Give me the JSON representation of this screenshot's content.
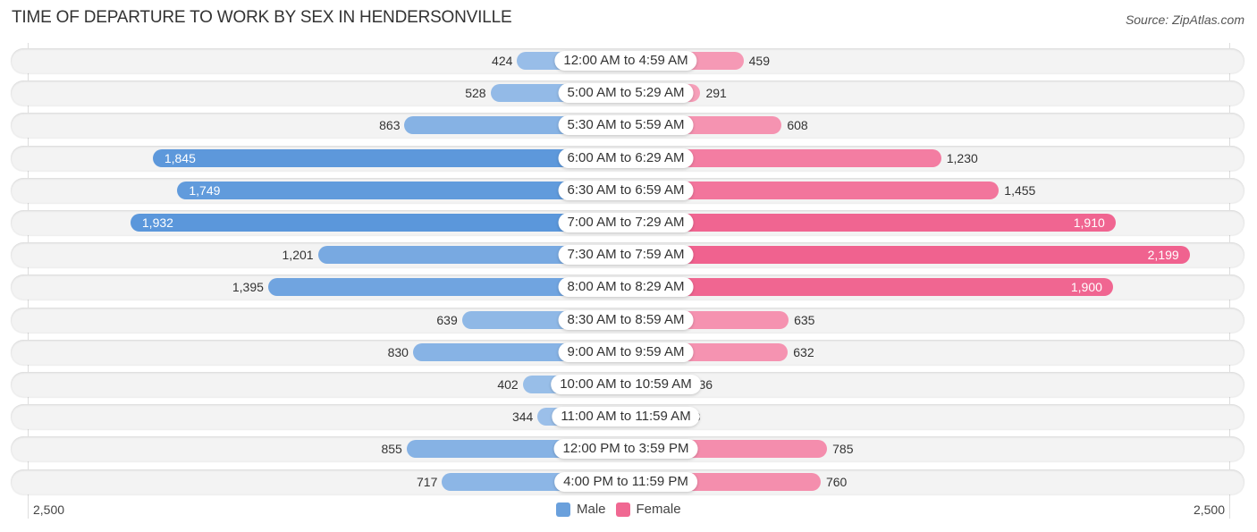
{
  "chart_data": {
    "type": "bar",
    "orientation": "horizontal-diverging",
    "title": "TIME OF DEPARTURE TO WORK BY SEX IN HENDERSONVILLE",
    "source": "Source: ZipAtlas.com",
    "categories": [
      "12:00 AM to 4:59 AM",
      "5:00 AM to 5:29 AM",
      "5:30 AM to 5:59 AM",
      "6:00 AM to 6:29 AM",
      "6:30 AM to 6:59 AM",
      "7:00 AM to 7:29 AM",
      "7:30 AM to 7:59 AM",
      "8:00 AM to 8:29 AM",
      "8:30 AM to 8:59 AM",
      "9:00 AM to 9:59 AM",
      "10:00 AM to 10:59 AM",
      "11:00 AM to 11:59 AM",
      "12:00 PM to 3:59 PM",
      "4:00 PM to 11:59 PM"
    ],
    "series": [
      {
        "name": "Male",
        "color": "#6aa0dc",
        "values": [
          424,
          528,
          863,
          1845,
          1749,
          1932,
          1201,
          1395,
          639,
          830,
          402,
          344,
          855,
          717
        ],
        "labels": [
          "424",
          "528",
          "863",
          "1,845",
          "1,749",
          "1,932",
          "1,201",
          "1,395",
          "639",
          "830",
          "402",
          "344",
          "855",
          "717"
        ]
      },
      {
        "name": "Female",
        "color": "#f06892",
        "values": [
          459,
          291,
          608,
          1230,
          1455,
          1910,
          2199,
          1900,
          635,
          632,
          236,
          188,
          785,
          760
        ],
        "labels": [
          "459",
          "291",
          "608",
          "1,230",
          "1,455",
          "1,910",
          "2,199",
          "1,900",
          "635",
          "632",
          "236",
          "188",
          "785",
          "760"
        ]
      }
    ],
    "axis": {
      "left_tick": "2,500",
      "right_tick": "2,500",
      "max": 2500
    },
    "legend": {
      "position": "bottom-center",
      "items": [
        "Male",
        "Female"
      ]
    }
  }
}
